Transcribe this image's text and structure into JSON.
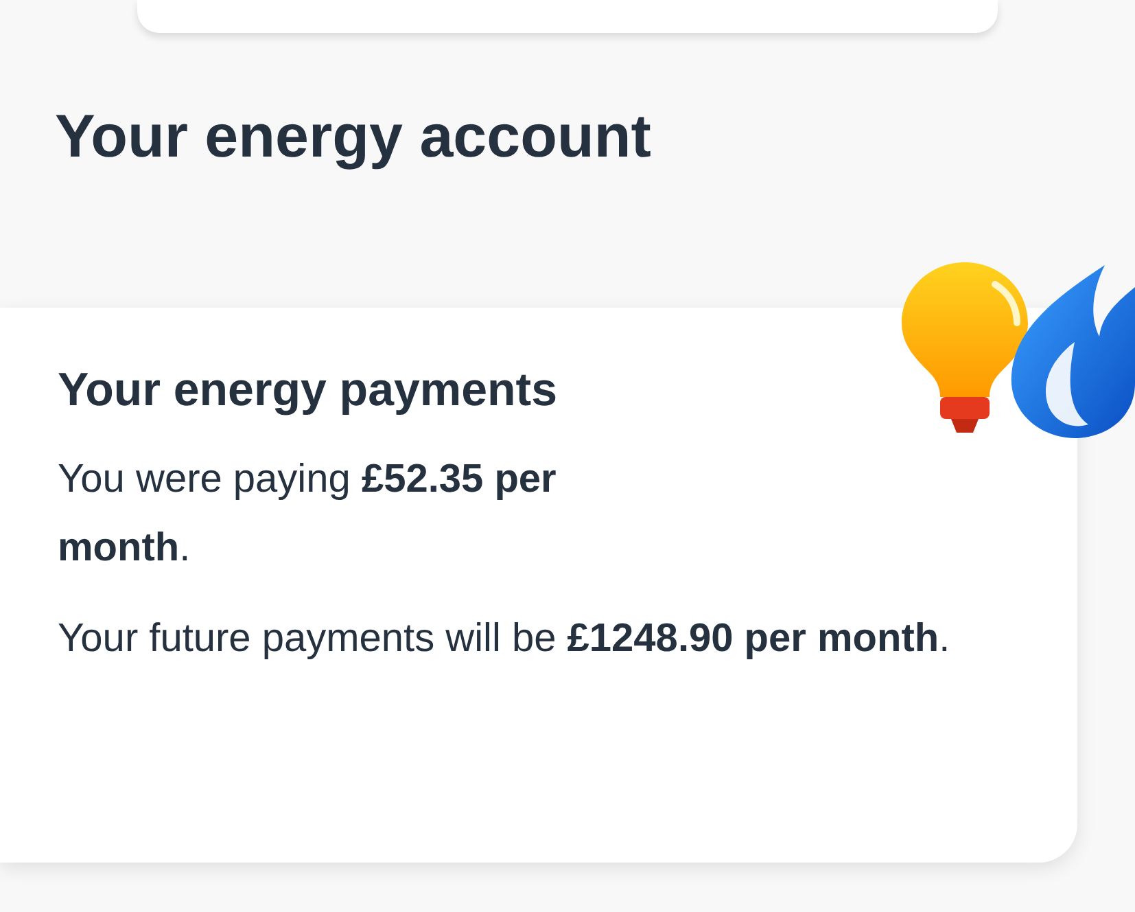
{
  "page": {
    "title": "Your energy account"
  },
  "payments_card": {
    "title": "Your energy payments",
    "paragraphs": [
      "You were paying **£52.35 per month**.",
      "Your future payments will be **£1248.90 per month**."
    ]
  }
}
